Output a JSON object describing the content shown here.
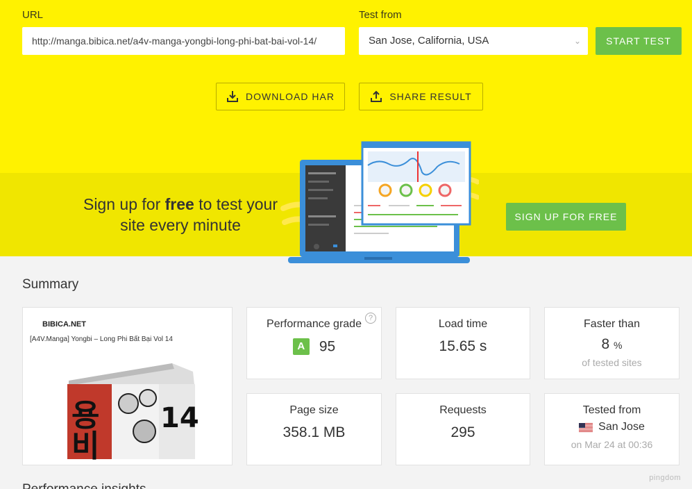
{
  "form": {
    "url_label": "URL",
    "url_value": "http://manga.bibica.net/a4v-manga-yongbi-long-phi-bat-bai-vol-14/",
    "test_from_label": "Test from",
    "test_from_value": "San Jose, California, USA",
    "start_test_label": "START TEST"
  },
  "actions": {
    "download_har": "DOWNLOAD HAR",
    "share_result": "SHARE RESULT"
  },
  "promo": {
    "text_pre": "Sign up for ",
    "text_bold": "free",
    "text_post": " to test your site every minute",
    "button": "SIGN UP FOR FREE"
  },
  "summary": {
    "title": "Summary",
    "thumbnail": {
      "site": "BIBICA.NET",
      "post": "[A4V.Manga] Yongbi – Long Phi Bất Bại Vol 14",
      "cover_number": "14"
    },
    "performance": {
      "title": "Performance grade",
      "grade": "A",
      "score": "95",
      "help": "?"
    },
    "load_time": {
      "title": "Load time",
      "value": "15.65 s"
    },
    "faster_than": {
      "title": "Faster than",
      "value": "8",
      "unit": "%",
      "sub": "of tested sites"
    },
    "page_size": {
      "title": "Page size",
      "value": "358.1 MB"
    },
    "requests": {
      "title": "Requests",
      "value": "295"
    },
    "tested_from": {
      "title": "Tested from",
      "value": "San Jose",
      "sub": "on Mar 24 at 00:36"
    }
  },
  "brand": "pingdom",
  "next_section_title": "Performance insights",
  "colors": {
    "yellow": "#fff200",
    "green": "#6cc04a",
    "band": "#f0e600"
  }
}
